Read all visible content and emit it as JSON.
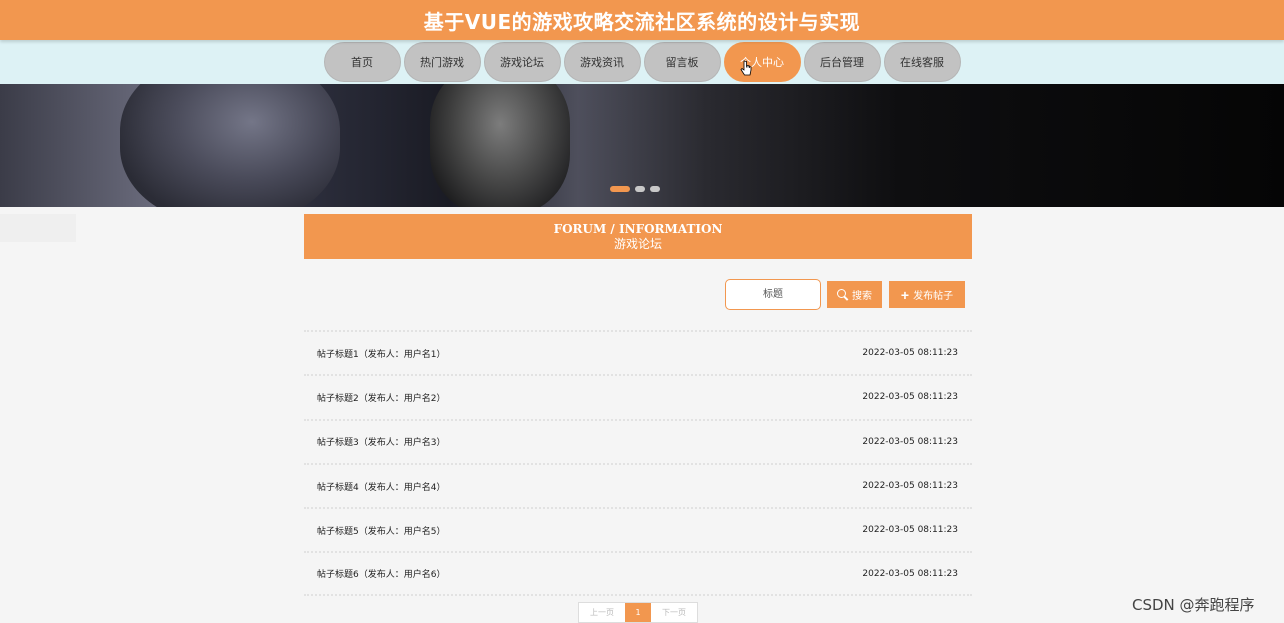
{
  "header": {
    "title": "基于VUE的游戏攻略交流社区系统的设计与实现"
  },
  "nav": {
    "items": [
      {
        "label": "首页"
      },
      {
        "label": "热门游戏"
      },
      {
        "label": "游戏论坛"
      },
      {
        "label": "游戏资讯"
      },
      {
        "label": "留言板"
      },
      {
        "label": "个人中心"
      },
      {
        "label": "后台管理"
      },
      {
        "label": "在线客服"
      }
    ],
    "active_index": 5
  },
  "banner": {
    "dots": 3,
    "active_dot": 0
  },
  "section": {
    "title_en": "FORUM / INFORMATION",
    "title_cn": "游戏论坛"
  },
  "search": {
    "placeholder": "标题",
    "search_label": "搜索",
    "post_label": "发布帖子"
  },
  "posts": [
    {
      "title": "帖子标题1（发布人：用户名1）",
      "time": "2022-03-05 08:11:23"
    },
    {
      "title": "帖子标题2（发布人：用户名2）",
      "time": "2022-03-05 08:11:23"
    },
    {
      "title": "帖子标题3（发布人：用户名3）",
      "time": "2022-03-05 08:11:23"
    },
    {
      "title": "帖子标题4（发布人：用户名4）",
      "time": "2022-03-05 08:11:23"
    },
    {
      "title": "帖子标题5（发布人：用户名5）",
      "time": "2022-03-05 08:11:23"
    },
    {
      "title": "帖子标题6（发布人：用户名6）",
      "time": "2022-03-05 08:11:23"
    }
  ],
  "pagination": {
    "prev_label": "上一页",
    "current": "1",
    "next_label": "下一页"
  },
  "watermark": "CSDN @奔跑程序",
  "colors": {
    "accent": "#f2974f",
    "nav_bg": "#ddf2f5",
    "nav_item": "#c2c2c2"
  }
}
